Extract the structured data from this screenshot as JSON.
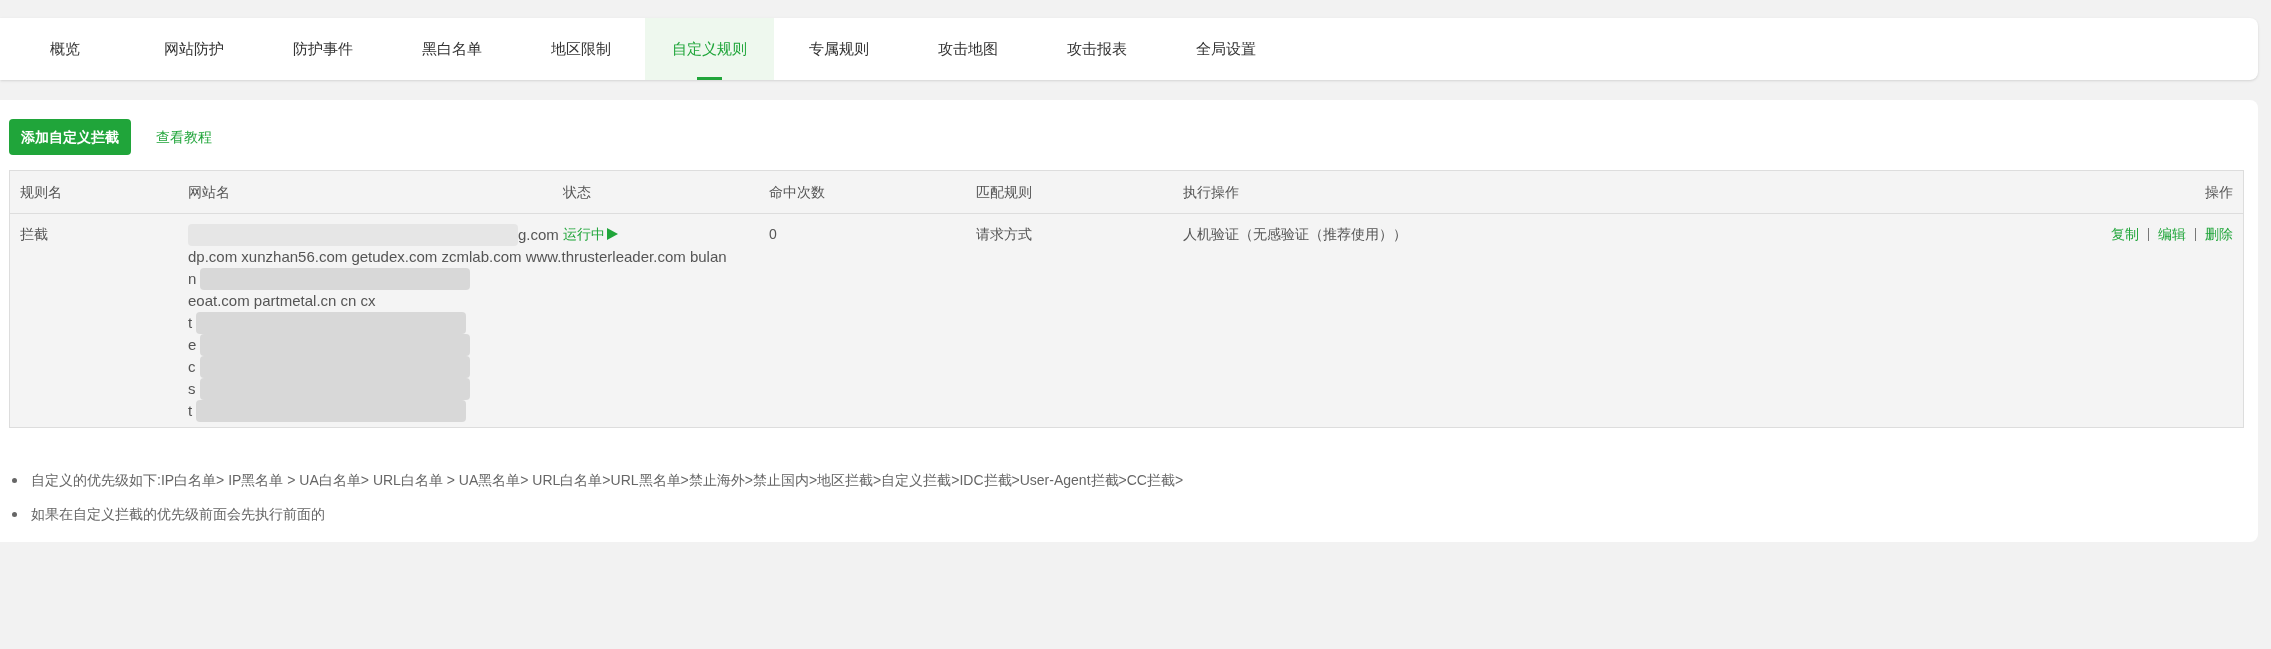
{
  "tabs": [
    {
      "label": "概览",
      "selected": false
    },
    {
      "label": "网站防护",
      "selected": false
    },
    {
      "label": "防护事件",
      "selected": false
    },
    {
      "label": "黑白名单",
      "selected": false
    },
    {
      "label": "地区限制",
      "selected": false
    },
    {
      "label": "自定义规则",
      "selected": true
    },
    {
      "label": "专属规则",
      "selected": false
    },
    {
      "label": "攻击地图",
      "selected": false
    },
    {
      "label": "攻击报表",
      "selected": false
    },
    {
      "label": "全局设置",
      "selected": false
    }
  ],
  "toolbar": {
    "add_button": "添加自定义拦截",
    "tutorial_link": "查看教程"
  },
  "table": {
    "columns": [
      "规则名",
      "网站名",
      "状态",
      "命中次数",
      "匹配规则",
      "执行操作",
      "操作"
    ],
    "rows": [
      {
        "name": "拦截",
        "site_lines": [
          {
            "text": "g.com",
            "redacted": true
          },
          {
            "text": "dp.com xunzhan56.com getudex.com zcmlab.com www.thrusterleader.com bulan",
            "redacted": false
          },
          {
            "text": "n",
            "redacted": true
          },
          {
            "text": "eoat.com partmetal.cn cn cx",
            "redacted": false
          },
          {
            "text": "t",
            "redacted": true
          },
          {
            "text": "e",
            "redacted": true
          },
          {
            "text": "c",
            "redacted": true
          },
          {
            "text": "s",
            "redacted": true
          },
          {
            "text": "t",
            "redacted": true
          }
        ],
        "status": "运行中",
        "running": true,
        "hits": "0",
        "match": "请求方式",
        "action": "人机验证（无感验证（推荐使用））",
        "ops": [
          "复制",
          "编辑",
          "删除"
        ]
      }
    ]
  },
  "notes": [
    "自定义的优先级如下:IP白名单> IP黑名单 > UA白名单> URL白名单 > UA黑名单> URL白名单>URL黑名单>禁止海外>禁止国内>地区拦截>自定义拦截>IDC拦截>User-Agent拦截>CC拦截>",
    "如果在自定义拦截的优先级前面会先执行前面的"
  ]
}
